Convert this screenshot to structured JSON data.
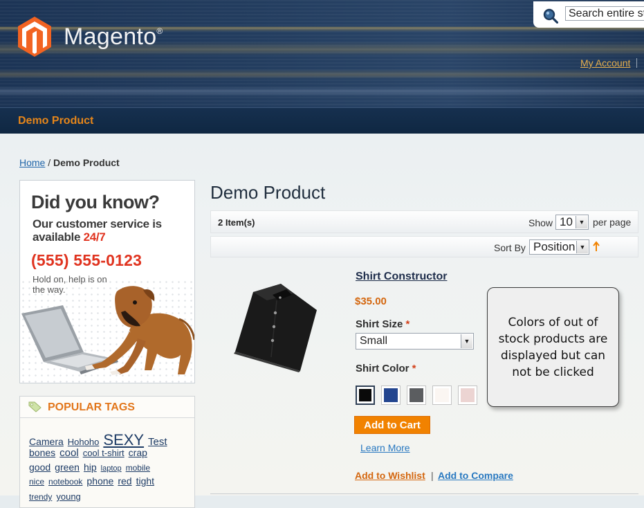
{
  "header": {
    "logo_text": "Magento",
    "logo_reg": "®",
    "search_placeholder": "Search entire store here...",
    "my_account": "My Account"
  },
  "nav": {
    "item": "Demo Product"
  },
  "breadcrumb": {
    "home": "Home",
    "sep": " / ",
    "current": "Demo Product"
  },
  "ad": {
    "headline": "Did you know?",
    "line1": "Our customer service is",
    "line2": "available ",
    "line2_highlight": "24/7",
    "phone": "(555) 555-0123",
    "small": "Hold on, help is on the way."
  },
  "popular_tags": {
    "title": "POPULAR TAGS",
    "rows": [
      [
        {
          "t": "Camera",
          "s": 14
        },
        {
          "t": "Hohoho",
          "s": 13
        },
        {
          "t": "SEXY",
          "s": 22
        },
        {
          "t": "Test",
          "s": 15
        }
      ],
      [
        {
          "t": "bones",
          "s": 14
        },
        {
          "t": "cool",
          "s": 15
        },
        {
          "t": "cool t-shirt",
          "s": 13
        },
        {
          "t": "crap",
          "s": 14
        }
      ],
      [
        {
          "t": "good",
          "s": 14
        },
        {
          "t": "green",
          "s": 14
        },
        {
          "t": "hip",
          "s": 14
        },
        {
          "t": "laptop",
          "s": 11
        },
        {
          "t": "mobile",
          "s": 12
        }
      ],
      [
        {
          "t": "nice",
          "s": 12
        },
        {
          "t": "notebook",
          "s": 12
        },
        {
          "t": "phone",
          "s": 14
        },
        {
          "t": "red",
          "s": 14
        },
        {
          "t": "tight",
          "s": 14
        }
      ],
      [
        {
          "t": "trendy",
          "s": 12
        },
        {
          "t": "young",
          "s": 13
        }
      ]
    ]
  },
  "main": {
    "title": "Demo Product",
    "toolbar": {
      "items_count": "2 Item(s)",
      "show_label": "Show",
      "per_page_value": "10",
      "per_page_label": "per page",
      "sort_label": "Sort By",
      "sort_value": "Position"
    },
    "product": {
      "name": "Shirt Constructor",
      "price": "$35.00",
      "size_label": "Shirt Size",
      "size_value": "Small",
      "color_label": "Shirt Color",
      "required_mark": "*",
      "swatches": [
        "#0a0a0a",
        "#23458f",
        "#5b5d60",
        "#fbf6f2",
        "#ecd4d2"
      ],
      "selected_swatch": 0,
      "add_to_cart": "Add to Cart",
      "learn_more": "Learn More",
      "add_to_wishlist": "Add to Wishlist",
      "link_separator": "|",
      "add_to_compare": "Add to Compare"
    }
  },
  "callout": {
    "text": "Colors of out of stock products are displayed but can not be clicked"
  },
  "colors": {
    "accent_orange": "#f18200",
    "link_blue": "#2878c0",
    "nav_orange": "#e6861a"
  }
}
